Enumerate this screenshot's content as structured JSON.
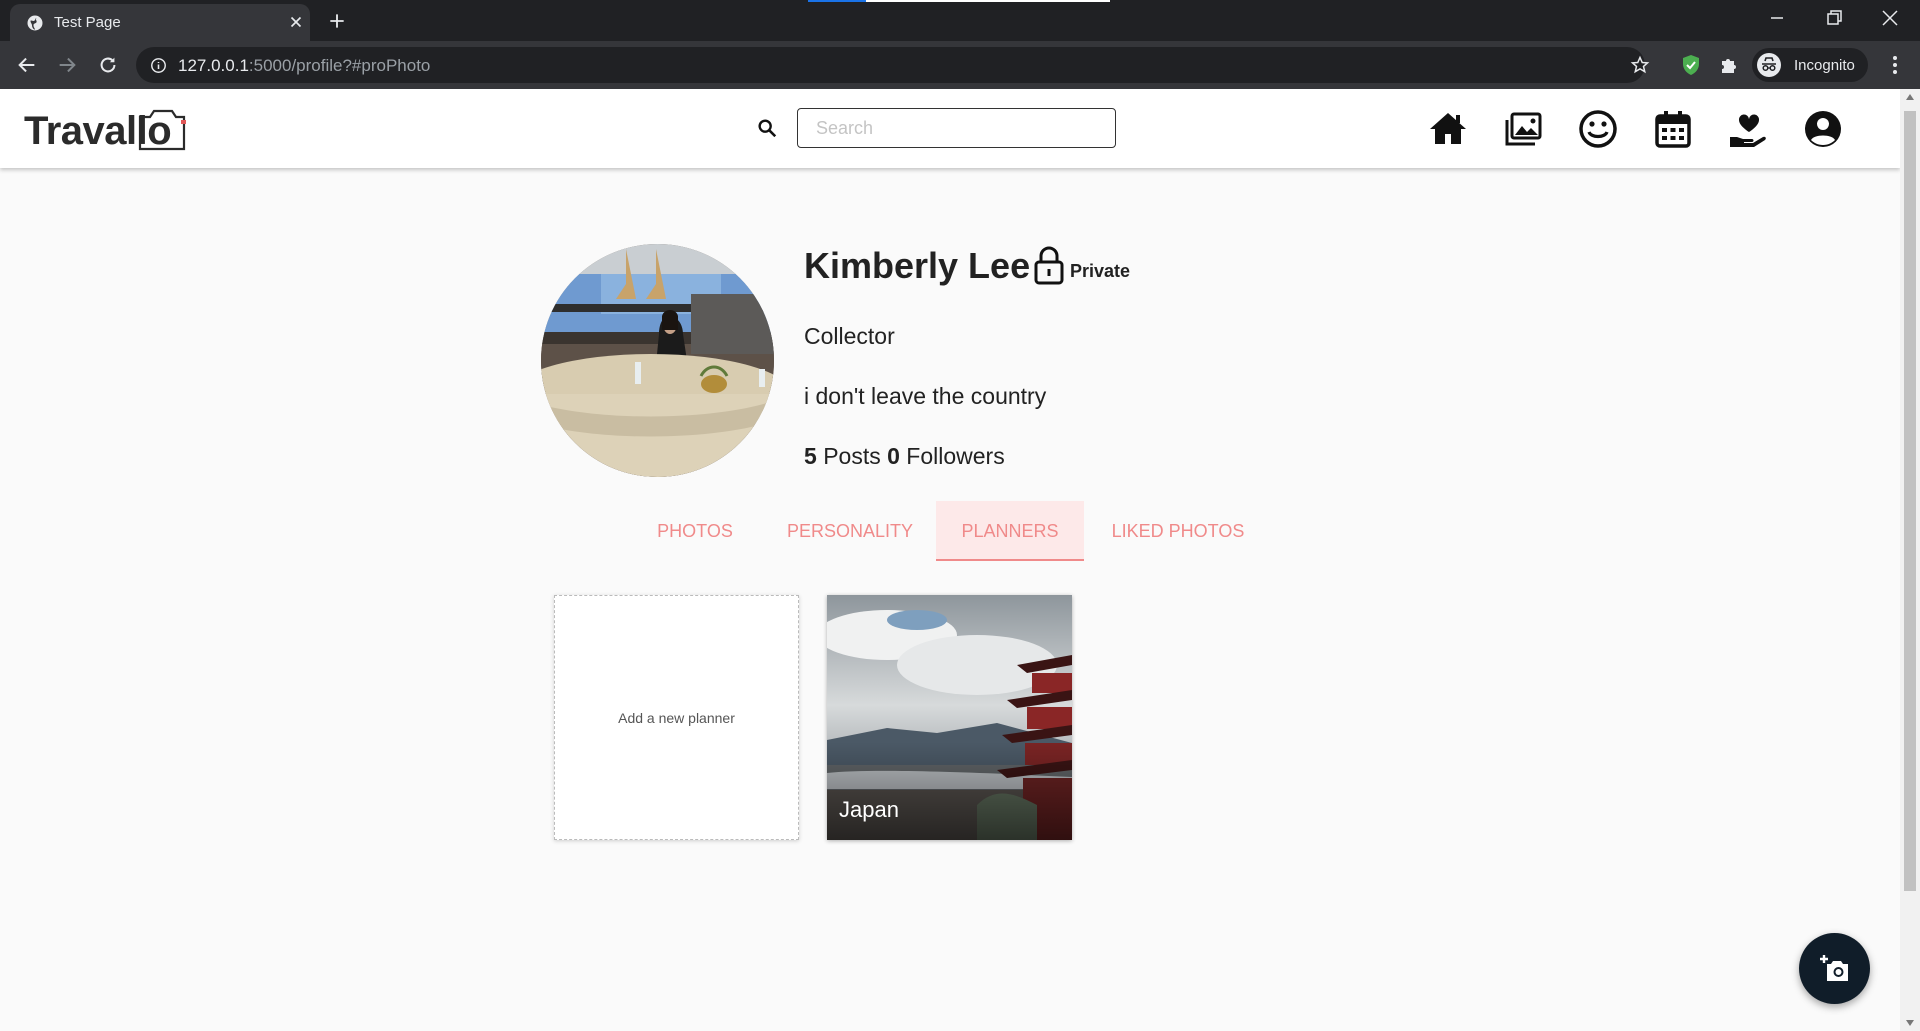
{
  "browser": {
    "tab_title": "Test Page",
    "url_host": "127.0.0.1",
    "url_path": ":5000/profile?#proPhoto",
    "incognito_label": "Incognito"
  },
  "navbar": {
    "logo_text": "Travallo",
    "search_placeholder": "Search",
    "icons": [
      "home-icon",
      "photo-library-icon",
      "smiley-icon",
      "calendar-icon",
      "donate-heart-icon",
      "account-circle-icon"
    ]
  },
  "profile": {
    "name": "Kimberly Lee",
    "privacy_label": "Private",
    "title": "Collector",
    "bio": "i don't leave the country",
    "posts_count": "5",
    "posts_label": "Posts",
    "followers_count": "0",
    "followers_label": "Followers"
  },
  "tabs": [
    {
      "label": "PHOTOS",
      "active": false
    },
    {
      "label": "PERSONALITY",
      "active": false
    },
    {
      "label": "PLANNERS",
      "active": true
    },
    {
      "label": "LIKED PHOTOS",
      "active": false
    }
  ],
  "planners": {
    "add_label": "Add a new planner",
    "items": [
      {
        "name": "Japan"
      }
    ]
  },
  "colors": {
    "tab_accent": "#f08a8a",
    "tab_active_bg": "#fde9e9",
    "fab_bg": "#101d29"
  }
}
